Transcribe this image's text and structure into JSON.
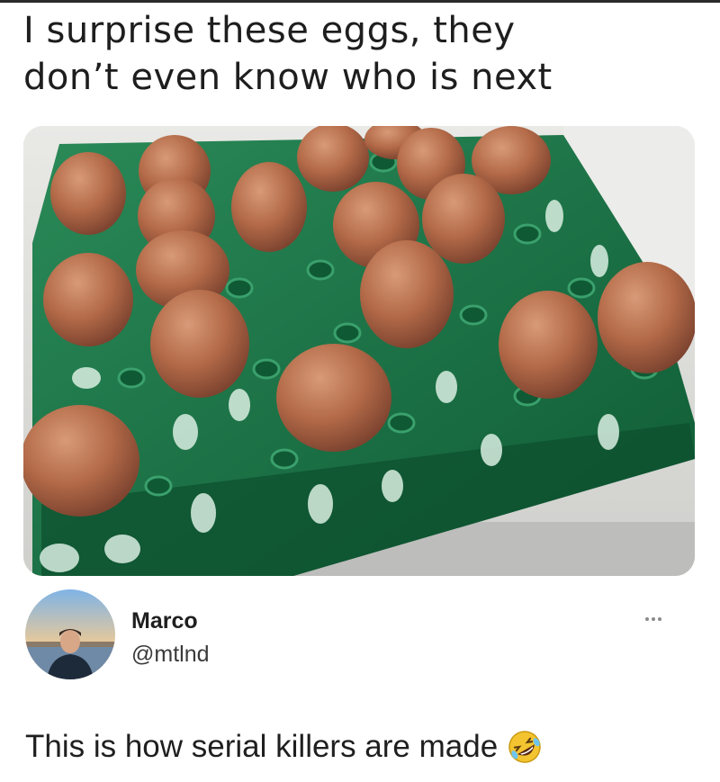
{
  "caption": {
    "line1": "I surprise these eggs, they",
    "line2": "don’t even know who is next"
  },
  "photo": {
    "subject": "egg-tray-photo",
    "colors": {
      "tray": "#1f7a4c",
      "egg": "#b9714f",
      "background": "#d8d8d6"
    }
  },
  "author": {
    "name": "Marco",
    "handle": "@mtlnd"
  },
  "post": {
    "text": "This is how serial killers are made",
    "emoji": "rolling-on-floor-laughing-icon"
  }
}
